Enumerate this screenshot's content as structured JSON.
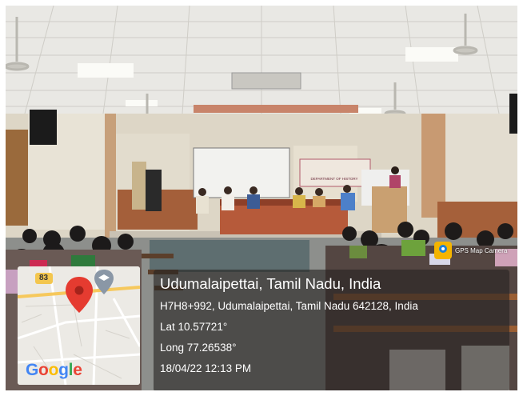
{
  "photo": {
    "description_icon": "seminar-hall-photo",
    "banner_lines": [
      "DEPARTMENT OF HISTORY"
    ]
  },
  "gps_overlay": {
    "app_badge": {
      "icon": "gps-map-camera-icon",
      "label": "GPS Map Camera"
    },
    "map": {
      "road_shield": "83",
      "marker_icon": "location-pin-icon",
      "place_icon": "graduation-cap-icon",
      "logo": [
        "G",
        "o",
        "o",
        "g",
        "l",
        "e"
      ],
      "logo_colors": [
        "#4285F4",
        "#EA4335",
        "#FBBC05",
        "#4285F4",
        "#34A853",
        "#EA4335"
      ]
    },
    "location_title": "Udumalaipettai, Tamil Nadu, India",
    "address": "H7H8+992, Udumalaipettai, Tamil Nadu 642128, India",
    "latitude": "Lat 10.57721°",
    "longitude": "Long 77.26538°",
    "datetime": "18/04/22 12:13 PM"
  }
}
